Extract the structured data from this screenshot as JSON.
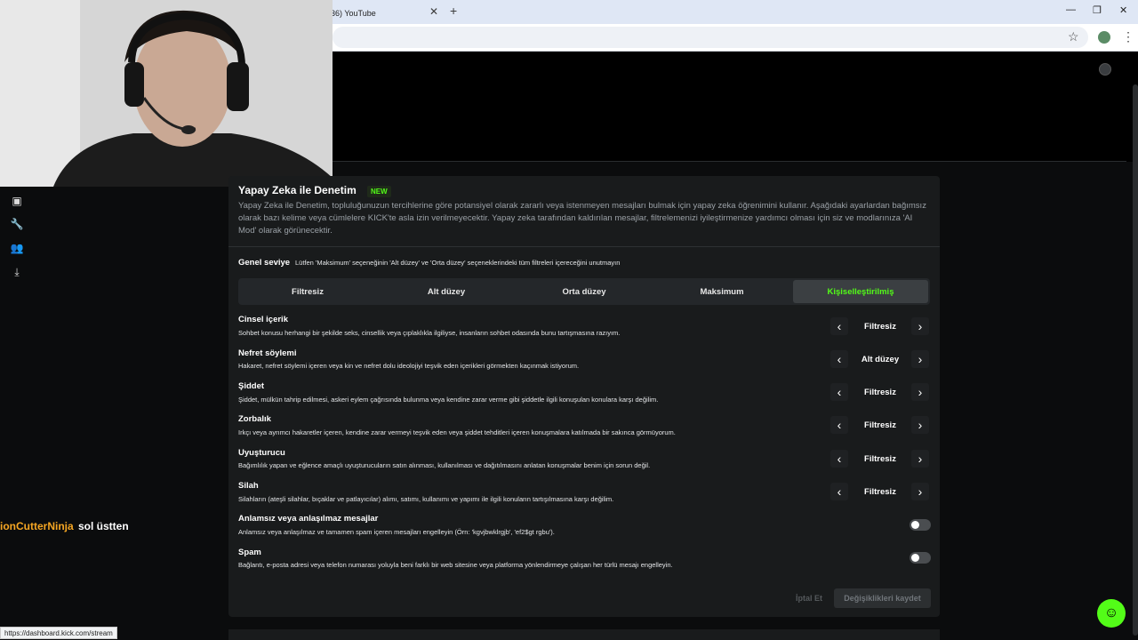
{
  "browser": {
    "tab_title": "36) YouTube",
    "tab_close": "✕",
    "new_tab": "+",
    "minimize": "—",
    "restore": "❐",
    "close": "✕",
    "status_url": "https://dashboard.kick.com/stream"
  },
  "chat": {
    "username": "ionCutterNinja",
    "message": "sol üstten"
  },
  "panel": {
    "title": "Yapay Zeka ile Denetim",
    "badge": "NEW",
    "description": "Yapay Zeka ile Denetim, topluluğunuzun tercihlerine göre potansiyel olarak zararlı veya istenmeyen mesajları bulmak için yapay zeka öğrenimini kullanır. Aşağıdaki ayarlardan bağımsız olarak bazı kelime veya cümlelere KICK'te asla izin verilmeyecektir. Yapay zeka tarafından kaldırılan mesajlar, filtrelemenizi iyileştirmenize yardımcı olması için siz ve modlarınıza 'AI Mod' olarak görünecektir.",
    "general_level_label": "Genel seviye",
    "general_level_hint": "Lütfen 'Maksimum' seçeneğinin 'Alt düzey' ve 'Orta düzey' seçeneklerindeki tüm filtreleri içereceğini unutmayın",
    "levels": [
      "Filtresiz",
      "Alt düzey",
      "Orta düzey",
      "Maksimum",
      "Kişiselleştirilmiş"
    ],
    "active_level": "Kişiselleştirilmiş",
    "categories": [
      {
        "title": "Cinsel içerik",
        "desc": "Sohbet konusu herhangi bir şekilde seks, cinsellik veya çıplaklıkla ilgiliyse, insanların sohbet odasında bunu tartışmasına razıyım.",
        "value": "Filtresiz"
      },
      {
        "title": "Nefret söylemi",
        "desc": "Hakaret, nefret söylemi içeren veya kin ve nefret dolu ideolojiyi teşvik eden içerikleri görmekten kaçınmak istiyorum.",
        "value": "Alt düzey"
      },
      {
        "title": "Şiddet",
        "desc": "Şiddet, mülkün tahrip edilmesi, askeri eylem çağrısında bulunma veya kendine zarar verme gibi şiddetle ilgili konuşulan konulara karşı değilim.",
        "value": "Filtresiz"
      },
      {
        "title": "Zorbalık",
        "desc": "Irkçı veya ayrımcı hakaretler içeren, kendine zarar vermeyi teşvik eden veya şiddet tehditleri içeren konuşmalara katılmada bir sakınca görmüyorum.",
        "value": "Filtresiz"
      },
      {
        "title": "Uyuşturucu",
        "desc": "Bağımlılık yapan ve eğlence amaçlı uyuşturucuların satın alınması, kullanılması ve dağıtılmasını anlatan konuşmalar benim için sorun değil.",
        "value": "Filtresiz"
      },
      {
        "title": "Silah",
        "desc": "Silahların (ateşli silahlar, bıçaklar ve patlayıcılar) alımı, satımı, kullanımı ve yapımı ile ilgili konuların tartışılmasına karşı değilim.",
        "value": "Filtresiz"
      }
    ],
    "toggles": [
      {
        "title": "Anlamsız veya anlaşılmaz mesajlar",
        "desc": "Anlamsız veya anlaşılmaz ve tamamen spam içeren mesajları engelleyin (Örn: 'kgvjbwklrgjb', 'ef2$gt rgbu').",
        "on": false
      },
      {
        "title": "Spam",
        "desc": "Bağlantı, e-posta adresi veya telefon numarası yoluyla beni farklı bir web sitesine veya platforma yönlendirmeye çalışan her türlü mesajı engelleyin.",
        "on": false
      }
    ],
    "cancel_label": "İptal Et",
    "save_label": "Değişiklikleri kaydet"
  }
}
